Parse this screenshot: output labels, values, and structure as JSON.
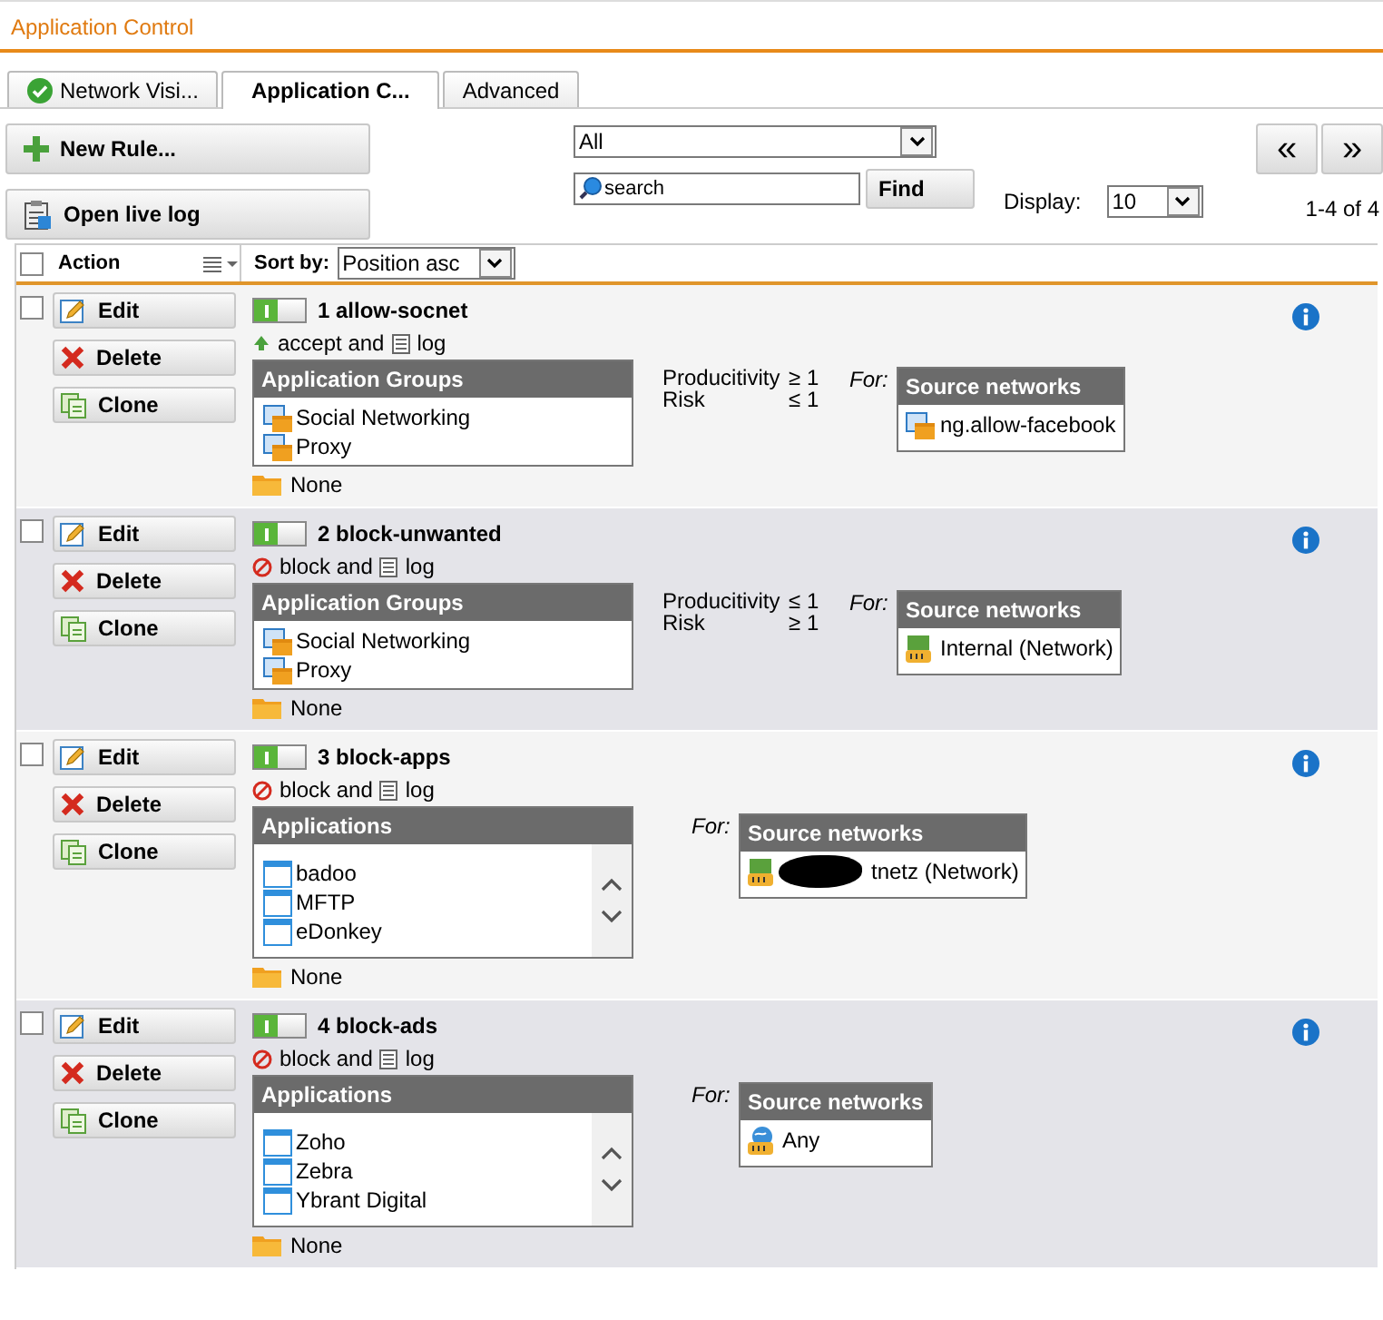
{
  "window": {
    "title": "Application Control"
  },
  "tabs": [
    {
      "label": "Network Visi...",
      "selected": false,
      "status_ok": true
    },
    {
      "label": "Application C...",
      "selected": true,
      "status_ok": false
    },
    {
      "label": "Advanced",
      "selected": false,
      "status_ok": false
    }
  ],
  "toolbar": {
    "new_rule": "New Rule...",
    "open_log": "Open live log",
    "filter_value": "All",
    "search_placeholder": "search",
    "find": "Find",
    "display_label": "Display:",
    "display_value": "10",
    "paging": "1-4 of 4",
    "prev": "«",
    "next": "»"
  },
  "table": {
    "select_all_checked": false,
    "action_label": "Action",
    "sort_label": "Sort by:",
    "sort_value": "Position asc",
    "rules": [
      {
        "checked": false,
        "buttons": [
          {
            "kind": "edit",
            "label": "Edit"
          },
          {
            "kind": "delete",
            "label": "Delete"
          },
          {
            "kind": "clone",
            "label": "Clone"
          }
        ],
        "enabled": true,
        "title": "1 allow-socnet",
        "action": {
          "kind": "accept",
          "text": "accept and"
        },
        "log": "log",
        "objects": {
          "title": "Application Groups",
          "kind": "group",
          "scrollable": false,
          "items": [
            "Social Networking",
            "Proxy"
          ]
        },
        "folder": "None",
        "criteria": [
          {
            "name": "Producitivity",
            "value": "≥ 1"
          },
          {
            "name": "Risk",
            "value": "≤ 1"
          }
        ],
        "for_label": "For:",
        "sources": {
          "title": "Source networks",
          "items": [
            {
              "kind": "group",
              "label": "ng.allow-facebook",
              "redacted": false
            }
          ]
        }
      },
      {
        "checked": false,
        "buttons": [
          {
            "kind": "edit",
            "label": "Edit"
          },
          {
            "kind": "delete",
            "label": "Delete"
          },
          {
            "kind": "clone",
            "label": "Clone"
          }
        ],
        "enabled": true,
        "title": "2 block-unwanted",
        "action": {
          "kind": "block",
          "text": "block and"
        },
        "log": "log",
        "objects": {
          "title": "Application Groups",
          "kind": "group",
          "scrollable": false,
          "items": [
            "Social Networking",
            "Proxy"
          ]
        },
        "folder": "None",
        "criteria": [
          {
            "name": "Producitivity",
            "value": "≤ 1"
          },
          {
            "name": "Risk",
            "value": "≥ 1"
          }
        ],
        "for_label": "For:",
        "sources": {
          "title": "Source networks",
          "items": [
            {
              "kind": "network",
              "label": "Internal (Network)",
              "redacted": false
            }
          ]
        }
      },
      {
        "checked": false,
        "buttons": [
          {
            "kind": "edit",
            "label": "Edit"
          },
          {
            "kind": "delete",
            "label": "Delete"
          },
          {
            "kind": "clone",
            "label": "Clone"
          }
        ],
        "enabled": true,
        "title": "3 block-apps",
        "action": {
          "kind": "block",
          "text": "block and"
        },
        "log": "log",
        "objects": {
          "title": "Applications",
          "kind": "app",
          "scrollable": true,
          "items": [
            "badoo",
            "MFTP",
            "eDonkey"
          ]
        },
        "folder": "None",
        "for_label": "For:",
        "sources": {
          "title": "Source networks",
          "items": [
            {
              "kind": "network",
              "label": "tnetz (Network)",
              "redacted": true
            }
          ]
        }
      },
      {
        "checked": false,
        "buttons": [
          {
            "kind": "edit",
            "label": "Edit"
          },
          {
            "kind": "delete",
            "label": "Delete"
          },
          {
            "kind": "clone",
            "label": "Clone"
          }
        ],
        "enabled": true,
        "title": "4 block-ads",
        "action": {
          "kind": "block",
          "text": "block and"
        },
        "log": "log",
        "objects": {
          "title": "Applications",
          "kind": "app",
          "scrollable": true,
          "items": [
            "Zoho",
            "Zebra",
            "Ybrant Digital"
          ]
        },
        "folder": "None",
        "for_label": "For:",
        "sources": {
          "title": "Source networks",
          "items": [
            {
              "kind": "any",
              "label": "Any",
              "redacted": false
            }
          ]
        }
      }
    ]
  }
}
